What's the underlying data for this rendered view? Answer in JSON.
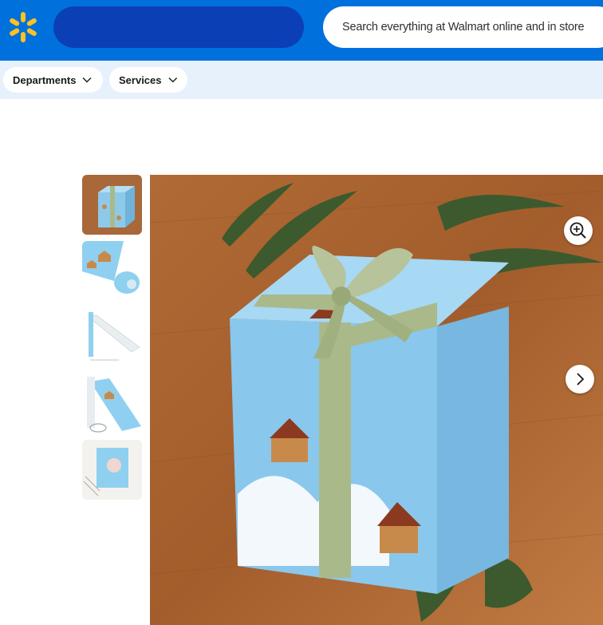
{
  "header": {
    "search": {
      "placeholder": "Search everything at Walmart online and in store"
    },
    "brand_color": "#0071dc",
    "logo_color": "#ffc220",
    "logo_icon": "walmart-spark-icon"
  },
  "subnav": {
    "departments_label": "Departments",
    "services_label": "Services"
  },
  "gallery": {
    "thumbnails": [
      {
        "name": "wrapped-gift-box"
      },
      {
        "name": "paper-roll-sheet"
      },
      {
        "name": "paper-roll-dimensions"
      },
      {
        "name": "paper-roll-with-scissors"
      },
      {
        "name": "gift-with-card"
      }
    ],
    "zoom_icon": "zoom-in-icon",
    "next_icon": "chevron-right-icon"
  }
}
